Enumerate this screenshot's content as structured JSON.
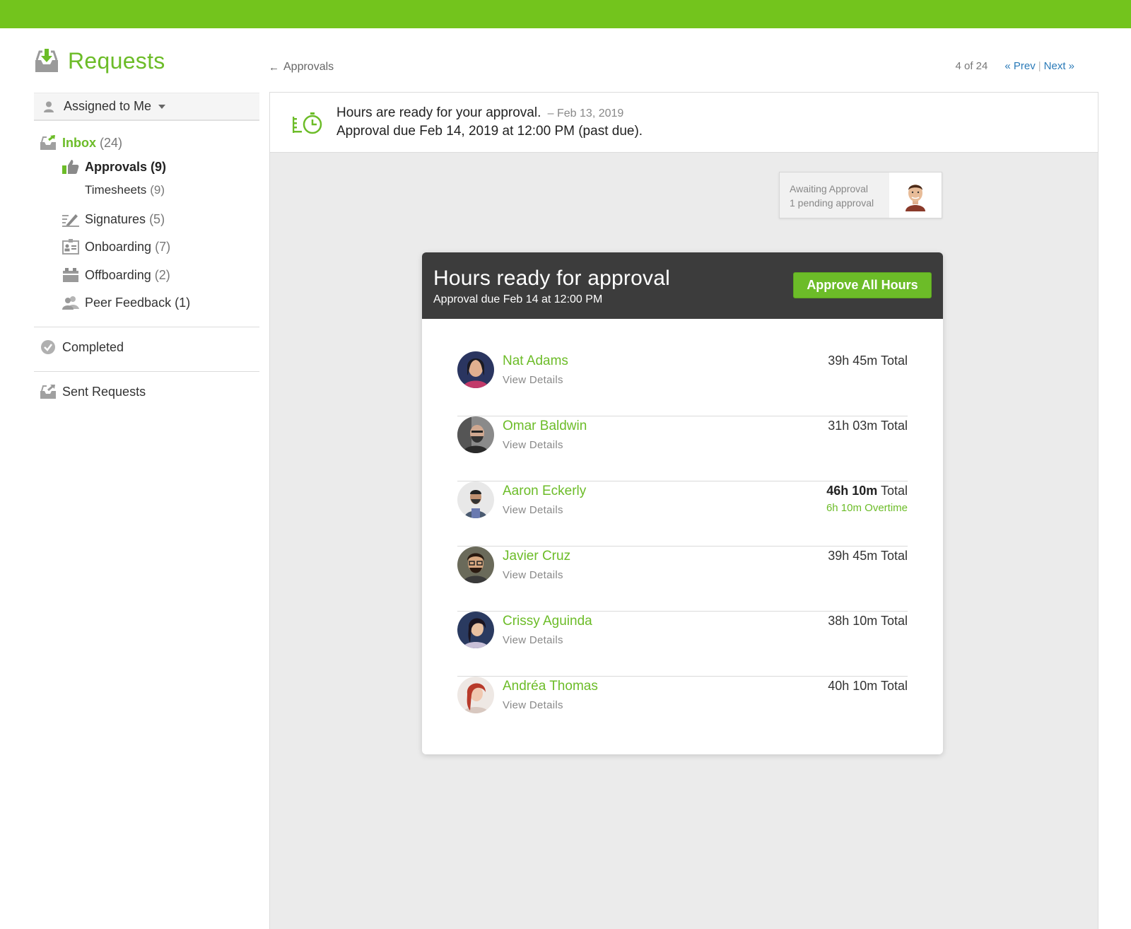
{
  "header": {
    "title": "Requests",
    "back_label": "Approvals",
    "pager": {
      "count": "4 of 24",
      "prev": "« Prev",
      "next": "Next »"
    }
  },
  "sidebar": {
    "filter": "Assigned to Me",
    "inbox": {
      "label": "Inbox",
      "count": "(24)"
    },
    "approvals": {
      "label": "Approvals",
      "count": "(9)"
    },
    "timesheets": {
      "label": "Timesheets",
      "count": "(9)"
    },
    "signatures": {
      "label": "Signatures",
      "count": "(5)"
    },
    "onboarding": {
      "label": "Onboarding",
      "count": "(7)"
    },
    "offboarding": {
      "label": "Offboarding",
      "count": "(2)"
    },
    "peer_feedback": {
      "label": "Peer Feedback",
      "count": "(1)"
    },
    "completed": "Completed",
    "sent": "Sent Requests"
  },
  "notice": {
    "message": "Hours are ready for your approval.",
    "date": "– Feb 13, 2019",
    "due": "Approval due Feb 14, 2019 at 12:00 PM (past due)."
  },
  "awaiting": {
    "line1": "Awaiting Approval",
    "line2": "1 pending approval"
  },
  "card": {
    "title": "Hours ready for approval",
    "subtitle": "Approval due Feb 14 at 12:00 PM",
    "approve_label": "Approve All Hours",
    "details_label": "View Details",
    "total_suffix": "Total",
    "employees": [
      {
        "name": "Nat Adams",
        "hours": "39h 45m",
        "overtime": ""
      },
      {
        "name": "Omar Baldwin",
        "hours": "31h 03m",
        "overtime": ""
      },
      {
        "name": "Aaron Eckerly",
        "hours": "46h 10m",
        "overtime": "6h 10m Overtime"
      },
      {
        "name": "Javier Cruz",
        "hours": "39h 45m",
        "overtime": ""
      },
      {
        "name": "Crissy Aguinda",
        "hours": "38h 10m",
        "overtime": ""
      },
      {
        "name": "Andréa Thomas",
        "hours": "40h 10m",
        "overtime": ""
      }
    ]
  },
  "colors": {
    "brand_green": "#73c41d",
    "link_green": "#6cbc28",
    "link_blue": "#2a7ab8",
    "card_header": "#3c3c3c"
  }
}
